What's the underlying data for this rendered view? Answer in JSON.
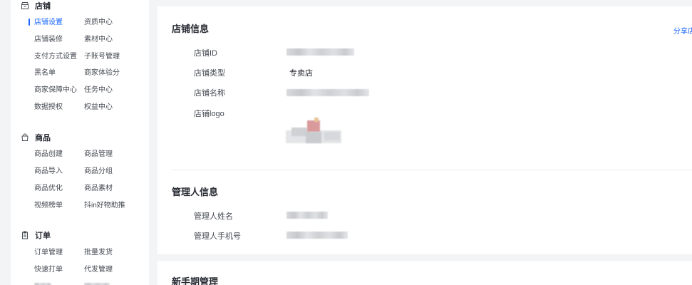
{
  "sidebar": {
    "sections": [
      {
        "title": "店铺",
        "icon": "store-icon",
        "items": [
          [
            "店铺设置",
            "资质中心"
          ],
          [
            "店铺装修",
            "素材中心"
          ],
          [
            "支付方式设置",
            "子账号管理"
          ],
          [
            "黑名单",
            "商家体验分"
          ],
          [
            "商家保障中心",
            "任务中心"
          ],
          [
            "数据授权",
            "权益中心"
          ]
        ]
      },
      {
        "title": "商品",
        "icon": "bag-icon",
        "items": [
          [
            "商品创建",
            "商品管理"
          ],
          [
            "商品导入",
            "商品分组"
          ],
          [
            "商品优化",
            "商品素材"
          ],
          [
            "视频榜单",
            "抖in好物助推"
          ]
        ]
      },
      {
        "title": "订单",
        "icon": "clipboard-icon",
        "items": [
          [
            "订单管理",
            "批量发货"
          ],
          [
            "快速打单",
            "代发管理"
          ]
        ]
      }
    ],
    "active_item": "店铺设置"
  },
  "store_info": {
    "title": "店铺信息",
    "share_label": "分享店",
    "id_label": "店铺ID",
    "type_label": "店铺类型",
    "type_value": "专卖店",
    "name_label": "店铺名称",
    "logo_label": "店铺logo"
  },
  "admin_info": {
    "title": "管理人信息",
    "name_label": "管理人姓名",
    "phone_label": "管理人手机号"
  },
  "newbie": {
    "title": "新手期管理"
  },
  "colors": {
    "accent": "#1966ff",
    "page_bg": "#f3f4f6",
    "card_bg": "#ffffff"
  }
}
